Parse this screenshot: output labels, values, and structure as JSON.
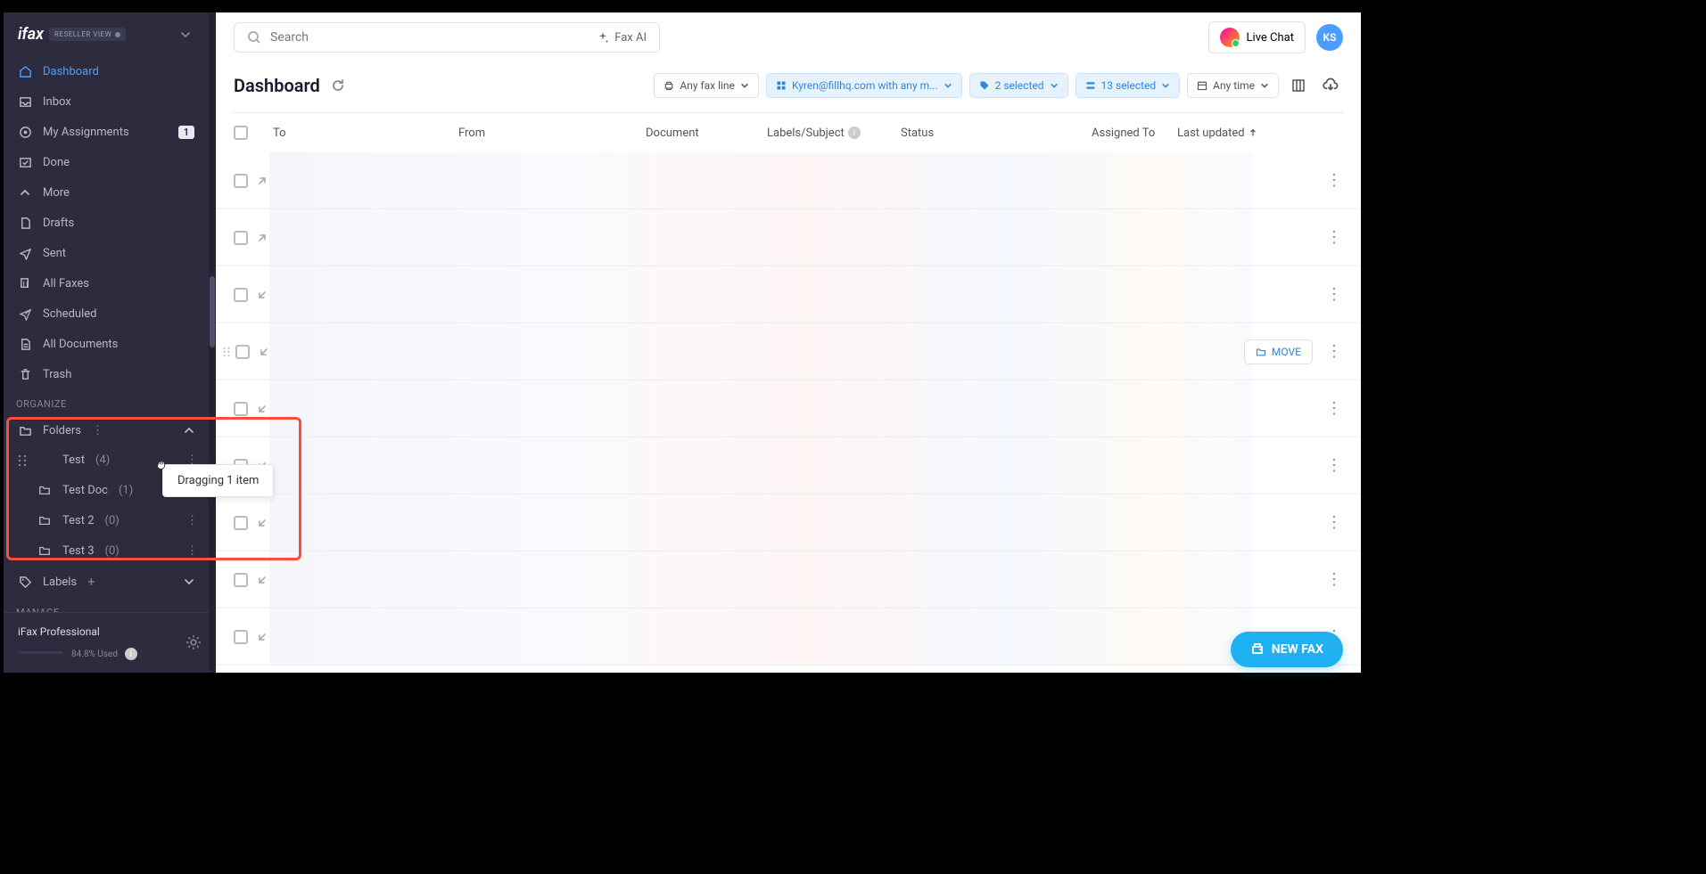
{
  "brand": {
    "name": "ifax",
    "reseller_label": "RESELLER VIEW"
  },
  "sidebar": {
    "nav": [
      {
        "label": "Dashboard",
        "icon": "home"
      },
      {
        "label": "Inbox",
        "icon": "inbox"
      },
      {
        "label": "My Assignments",
        "icon": "assignment",
        "badge": "1"
      },
      {
        "label": "Done",
        "icon": "done"
      },
      {
        "label": "More",
        "icon": "chevron-up"
      },
      {
        "label": "Drafts",
        "icon": "draft"
      },
      {
        "label": "Sent",
        "icon": "sent"
      },
      {
        "label": "All Faxes",
        "icon": "all"
      },
      {
        "label": "Scheduled",
        "icon": "scheduled"
      },
      {
        "label": "All Documents",
        "icon": "docs"
      },
      {
        "label": "Trash",
        "icon": "trash"
      }
    ],
    "organize_header": "ORGANIZE",
    "folders_label": "Folders",
    "folders": [
      {
        "name": "Test",
        "count": "(4)",
        "drag": true
      },
      {
        "name": "Test Doc",
        "count": "(1)"
      },
      {
        "name": "Test 2",
        "count": "(0)"
      },
      {
        "name": "Test 3",
        "count": "(0)"
      }
    ],
    "labels_label": "Labels",
    "manage_header": "MANAGE",
    "plan": {
      "name": "iFax Professional",
      "used_label": "84.8% Used",
      "used_pct": 84.8
    }
  },
  "drag_tooltip": "Dragging 1 item",
  "topbar": {
    "search_placeholder": "Search",
    "fax_ai_label": "Fax AI",
    "live_chat_label": "Live Chat",
    "user_initials": "KS"
  },
  "page": {
    "title": "Dashboard",
    "filters": {
      "faxline": "Any fax line",
      "member": "Kyren@fillhq.com with any m...",
      "labels_selected": "2 selected",
      "status_selected": "13 selected",
      "time": "Any time"
    },
    "columns": {
      "to": "To",
      "from": "From",
      "document": "Document",
      "labels": "Labels/Subject",
      "status": "Status",
      "assigned": "Assigned To",
      "updated": "Last updated"
    },
    "rows": [
      {
        "dir": "out"
      },
      {
        "dir": "out"
      },
      {
        "dir": "in"
      },
      {
        "dir": "in",
        "drag": true,
        "move": true
      },
      {
        "dir": "in"
      },
      {
        "dir": "in"
      },
      {
        "dir": "in"
      },
      {
        "dir": "in"
      },
      {
        "dir": "in"
      }
    ],
    "move_label": "MOVE",
    "new_fax_label": "NEW FAX"
  }
}
